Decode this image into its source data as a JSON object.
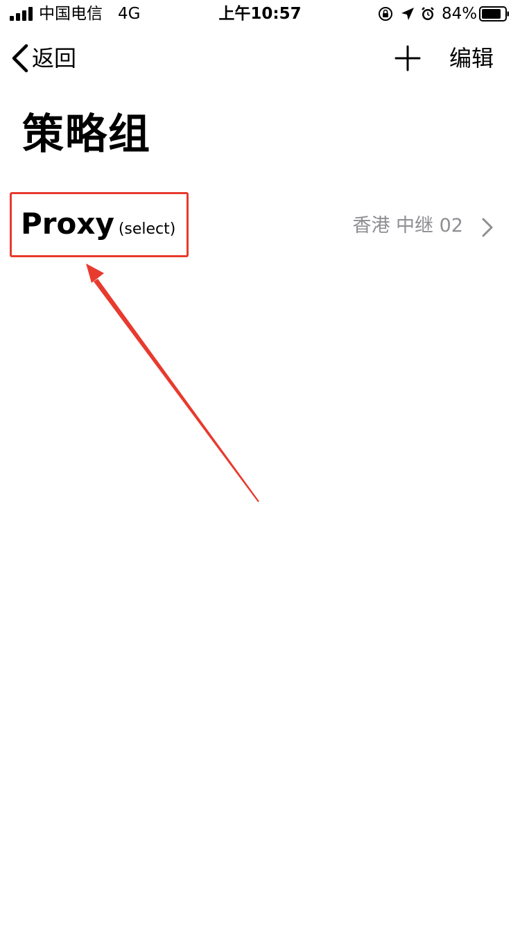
{
  "status_bar": {
    "carrier": "中国电信",
    "network": "4G",
    "time": "上午10:57",
    "battery_percent": "84%",
    "icons": [
      "signal-icon",
      "orientation-lock-icon",
      "location-arrow-icon",
      "alarm-icon",
      "battery-icon"
    ]
  },
  "nav": {
    "back_label": "返回",
    "add_icon": "plus-icon",
    "edit_label": "编辑"
  },
  "page": {
    "title": "策略组"
  },
  "groups": [
    {
      "name": "Proxy",
      "type": "(select)",
      "selected": "香港 中继 02"
    }
  ],
  "annotation": {
    "color": "#e83a2e"
  }
}
